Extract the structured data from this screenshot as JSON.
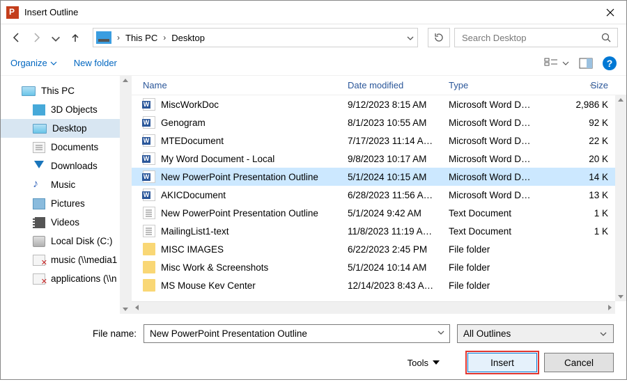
{
  "title": "Insert Outline",
  "breadcrumb": {
    "pc": "This PC",
    "folder": "Desktop"
  },
  "search_placeholder": "Search Desktop",
  "toolbar": {
    "organize": "Organize",
    "newfolder": "New folder"
  },
  "tree": {
    "thispc": "This PC",
    "items": [
      {
        "label": "3D Objects",
        "ico": "cube"
      },
      {
        "label": "Desktop",
        "ico": "monitor",
        "sel": true
      },
      {
        "label": "Documents",
        "ico": "docs"
      },
      {
        "label": "Downloads",
        "ico": "down"
      },
      {
        "label": "Music",
        "ico": "music"
      },
      {
        "label": "Pictures",
        "ico": "pics"
      },
      {
        "label": "Videos",
        "ico": "video"
      },
      {
        "label": "Local Disk (C:)",
        "ico": "disk"
      },
      {
        "label": "music (\\\\media1",
        "ico": "net"
      },
      {
        "label": "applications (\\\\n",
        "ico": "net"
      }
    ]
  },
  "columns": {
    "name": "Name",
    "date": "Date modified",
    "type": "Type",
    "size": "Size"
  },
  "files": [
    {
      "ico": "word",
      "name": "MiscWorkDoc",
      "date": "9/12/2023 8:15 AM",
      "type": "Microsoft Word D…",
      "size": "2,986 K"
    },
    {
      "ico": "word",
      "name": "Genogram",
      "date": "8/1/2023 10:55 AM",
      "type": "Microsoft Word D…",
      "size": "92 K"
    },
    {
      "ico": "word",
      "name": "MTEDocument",
      "date": "7/17/2023 11:14 A…",
      "type": "Microsoft Word D…",
      "size": "22 K"
    },
    {
      "ico": "word",
      "name": "My Word Document - Local",
      "date": "9/8/2023 10:17 AM",
      "type": "Microsoft Word D…",
      "size": "20 K"
    },
    {
      "ico": "word",
      "name": "New PowerPoint Presentation Outline",
      "date": "5/1/2024 10:15 AM",
      "type": "Microsoft Word D…",
      "size": "14 K",
      "sel": true
    },
    {
      "ico": "word",
      "name": "AKICDocument",
      "date": "6/28/2023 11:56 A…",
      "type": "Microsoft Word D…",
      "size": "13 K"
    },
    {
      "ico": "txt",
      "name": "New PowerPoint Presentation Outline",
      "date": "5/1/2024 9:42 AM",
      "type": "Text Document",
      "size": "1 K"
    },
    {
      "ico": "txt",
      "name": "MailingList1-text",
      "date": "11/8/2023 11:19 A…",
      "type": "Text Document",
      "size": "1 K"
    },
    {
      "ico": "folder",
      "name": "MISC IMAGES",
      "date": "6/22/2023 2:45 PM",
      "type": "File folder",
      "size": ""
    },
    {
      "ico": "folder",
      "name": "Misc Work & Screenshots",
      "date": "5/1/2024 10:14 AM",
      "type": "File folder",
      "size": ""
    },
    {
      "ico": "folder",
      "name": "MS Mouse Kev Center",
      "date": "12/14/2023 8:43 A…",
      "type": "File folder",
      "size": ""
    }
  ],
  "footer": {
    "filename_label": "File name:",
    "filename_value": "New PowerPoint Presentation Outline",
    "filter": "All Outlines",
    "tools": "Tools",
    "insert": "Insert",
    "cancel": "Cancel"
  }
}
